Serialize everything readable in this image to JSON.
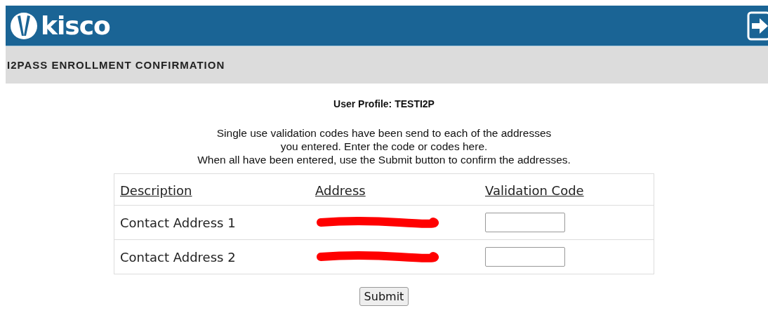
{
  "header": {
    "brand": "kisco"
  },
  "title_bar": {
    "title": "I2PASS ENROLLMENT CONFIRMATION"
  },
  "profile": "User Profile: TESTI2P",
  "instructions": [
    "Single use validation codes have been send to each of the addresses",
    "you entered. Enter the code or codes here.",
    "When all have been entered, use the Submit button to confirm the addresses."
  ],
  "table": {
    "columns": [
      "Description",
      "Address",
      "Validation Code"
    ],
    "rows": [
      {
        "description": "Contact Address 1",
        "address_redacted": true
      },
      {
        "description": "Contact Address 2",
        "address_redacted": true
      }
    ]
  },
  "submit": "Submit"
}
